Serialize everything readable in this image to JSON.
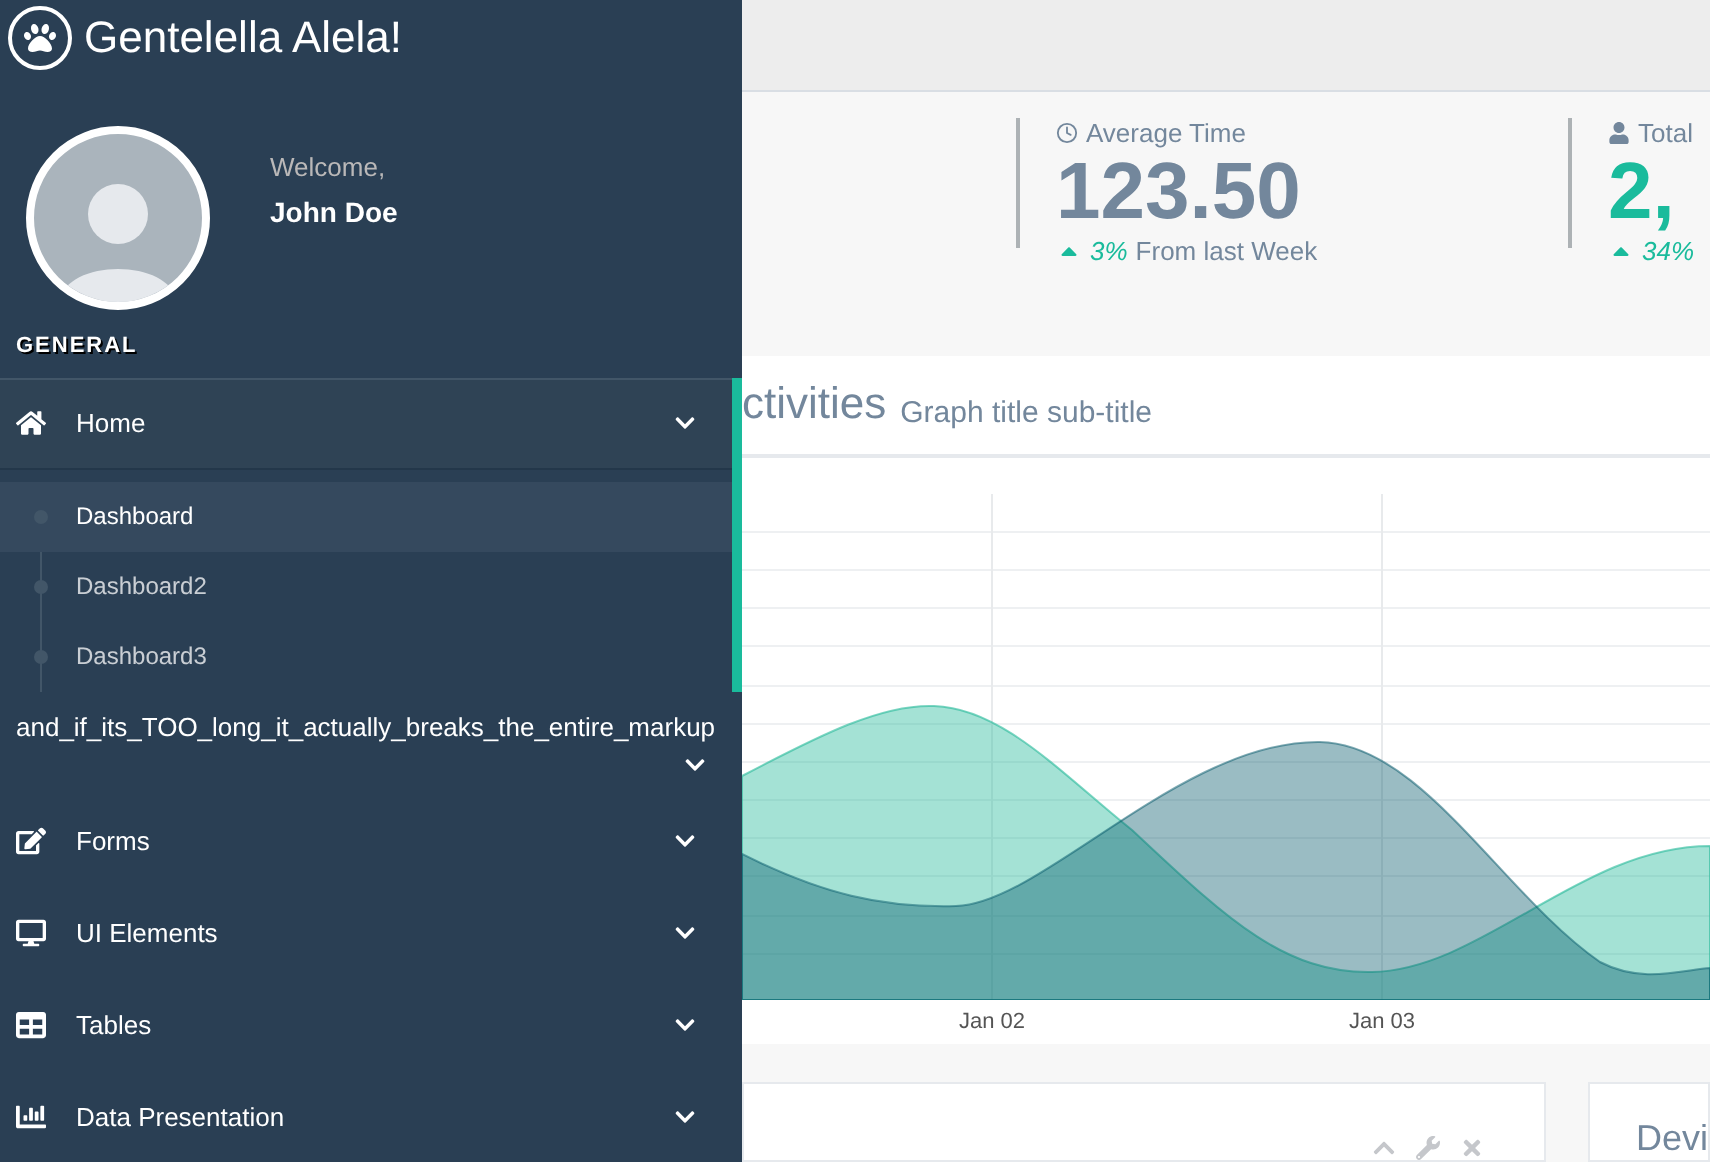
{
  "brand": {
    "title": "Gentelella Alela!"
  },
  "profile": {
    "greeting": "Welcome,",
    "name": "John Doe"
  },
  "menu_section": "GENERAL",
  "menu": [
    {
      "label": "Home",
      "kind": "home",
      "selected": true,
      "children": [
        {
          "label": "Dashboard",
          "selected": true
        },
        {
          "label": "Dashboard2",
          "selected": false
        },
        {
          "label": "Dashboard3",
          "selected": false
        }
      ]
    },
    {
      "label": "and_if_its_TOO_long_it_actually_breaks_the_entire_markup",
      "kind": "plain",
      "selected": false
    },
    {
      "label": "Forms",
      "kind": "edit",
      "selected": false
    },
    {
      "label": "UI Elements",
      "kind": "desktop",
      "selected": false
    },
    {
      "label": "Tables",
      "kind": "table",
      "selected": false
    },
    {
      "label": "Data Presentation",
      "kind": "chart",
      "selected": false
    }
  ],
  "stats": [
    {
      "kind": "clock",
      "label": "Average Time",
      "value": "123.50",
      "color": "#73879c",
      "change": "3%",
      "note": "From last Week"
    },
    {
      "kind": "user",
      "label": "Total",
      "value": "2,",
      "color": "#1abb9c",
      "change": "34%"
    }
  ],
  "chart_card": {
    "title": "ctivities",
    "subtitle": "Graph title sub-title",
    "x_labels": [
      "Jan 02",
      "Jan 03"
    ]
  },
  "bottom_cards": [
    {
      "kind": "tools"
    },
    {
      "kind": "title",
      "title": "Devi"
    }
  ]
}
